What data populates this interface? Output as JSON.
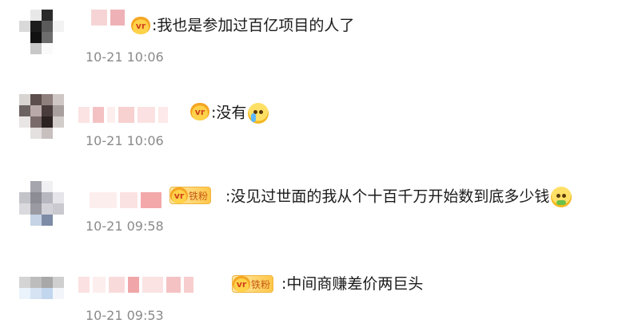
{
  "comments": [
    {
      "text": "我也是参加过百亿项目的人了",
      "time": "10-21 10:06",
      "badge_text": "",
      "emoji": ""
    },
    {
      "text": "没有",
      "time": "10-21 10:06",
      "badge_text": "",
      "emoji": "crying-face"
    },
    {
      "text": "没见过世面的我从个十百千万开始数到底多少钱",
      "time": "10-21 09:58",
      "badge_text": "铁粉",
      "emoji": "sick-face"
    },
    {
      "text": "中间商赚差价两巨头",
      "time": "10-21 09:53",
      "badge_text": "铁粉",
      "emoji": ""
    }
  ],
  "colors": {
    "text": "#1a1a1a",
    "timestamp": "#8a8a8a",
    "badge_gold": "#ffc74a",
    "badge_text": "#c45a12"
  }
}
